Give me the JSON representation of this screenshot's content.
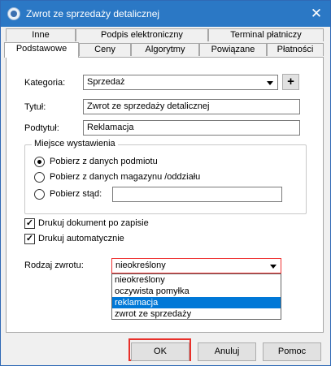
{
  "window": {
    "title": "Zwrot ze sprzedaży detalicznej",
    "close_glyph": "✕"
  },
  "tabs_row1": [
    "Inne",
    "Podpis elektroniczny",
    "Terminal płatniczy"
  ],
  "tabs_row2": [
    "Podstawowe",
    "Ceny",
    "Algorytmy",
    "Powiązane",
    "Płatności"
  ],
  "form": {
    "kategoria_label": "Kategoria:",
    "kategoria_value": "Sprzedaż",
    "plus_label": "+",
    "tytul_label": "Tytuł:",
    "tytul_value": "Zwrot ze sprzedaży detalicznej",
    "podtytul_label": "Podtytuł:",
    "podtytul_value": "Reklamacja",
    "group_title": "Miejsce wystawienia",
    "radio1": "Pobierz z danych podmiotu",
    "radio2": "Pobierz z danych magazynu /oddziału",
    "radio3": "Pobierz stąd:",
    "pobierz_stad_value": "",
    "check1": "Drukuj dokument po zapisie",
    "check2": "Drukuj automatycznie",
    "check_glyph": "✓",
    "rodzaj_label": "Rodzaj zwrotu:",
    "rodzaj_value": "nieokreślony",
    "rodzaj_options": [
      "nieokreślony",
      "oczywista pomyłka",
      "reklamacja",
      "zwrot ze sprzedaży"
    ],
    "rodzaj_highlighted": "reklamacja"
  },
  "buttons": {
    "ok": "OK",
    "cancel": "Anuluj",
    "help": "Pomoc"
  },
  "colors": {
    "titlebar": "#2b78c5",
    "selection": "#0078d7",
    "highlight": "#e8302a"
  }
}
